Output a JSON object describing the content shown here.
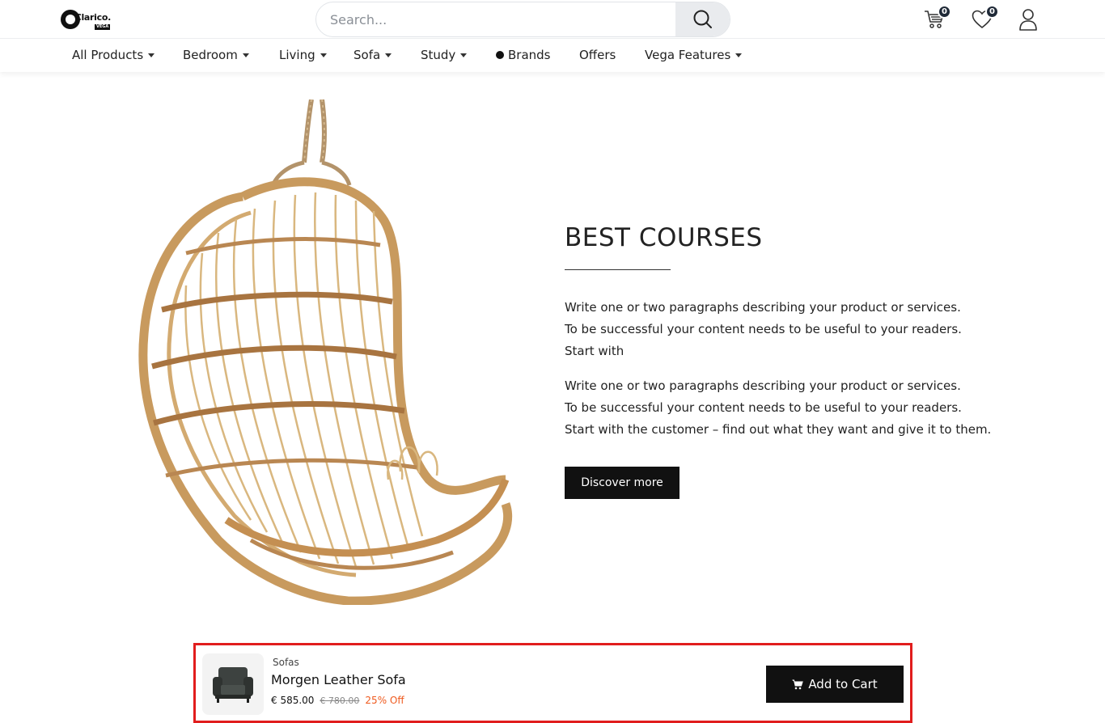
{
  "header": {
    "logo_text": "Clarico.",
    "logo_sub": "VEGA",
    "search_placeholder": "Search...",
    "cart_count": "0",
    "wishlist_count": "0"
  },
  "nav": {
    "items": [
      {
        "label": "All Products",
        "dropdown": true
      },
      {
        "label": "Bedroom",
        "dropdown": true
      },
      {
        "label": "Living",
        "dropdown": true
      },
      {
        "label": "Sofa",
        "dropdown": true
      },
      {
        "label": "Study",
        "dropdown": true
      },
      {
        "label": "Brands",
        "dropdown": false
      },
      {
        "label": "Offers",
        "dropdown": false
      },
      {
        "label": "Vega Features",
        "dropdown": true
      }
    ]
  },
  "hero": {
    "title": "BEST COURSES",
    "para1": [
      "Write one or two paragraphs describing your product or services.",
      "To be successful your content needs to be useful to your readers.",
      "Start with"
    ],
    "para2": [
      "Write one or two paragraphs describing your product or services.",
      "To be successful your content needs to be useful to your readers.",
      "Start with the customer – find out what they want and give it to them."
    ],
    "button": "Discover more"
  },
  "sticky": {
    "category": "Sofas",
    "name": "Morgen Leather Sofa",
    "price": "€ 585.00",
    "old_price": "€ 780.00",
    "discount": "25% Off",
    "button": "Add to Cart"
  },
  "colors": {
    "accent": "#111111",
    "discount": "#ef5a1e",
    "highlight_border": "#e11d1d"
  }
}
